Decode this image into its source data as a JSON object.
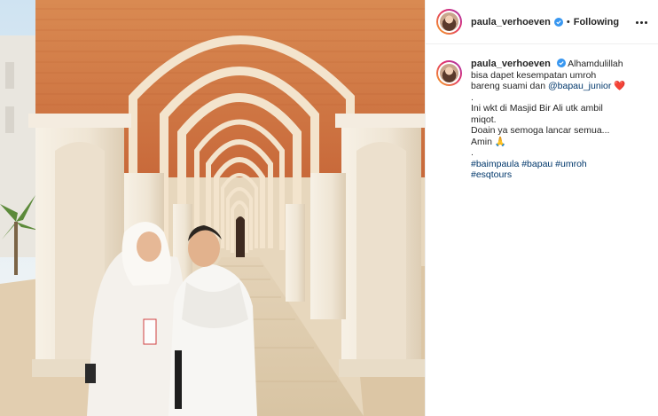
{
  "post": {
    "username": "paula_verhoeven",
    "follow_status": "Following",
    "separator": "•",
    "more_icon": "more-options-icon",
    "verified_color": "#3897f0"
  },
  "caption": {
    "username": "paula_verhoeven",
    "line1": "Alhamdulillah",
    "line2": "bisa dapet kesempatan umroh",
    "line3_text": "bareng suami dan",
    "line3_mention": "@bapau_junior",
    "line3_emoji": "❤️",
    "line4": ".",
    "line5": "Ini wkt di Masjid Bir Ali utk ambil",
    "line6": "miqot.",
    "line7": "Doain ya semoga lancar semua...",
    "line8_text": "Amin",
    "line8_emoji": "🙏",
    "line9": ".",
    "hashtags_line1": "#baimpaula #bapau #umroh",
    "hashtags_line2": "#esqtours"
  }
}
